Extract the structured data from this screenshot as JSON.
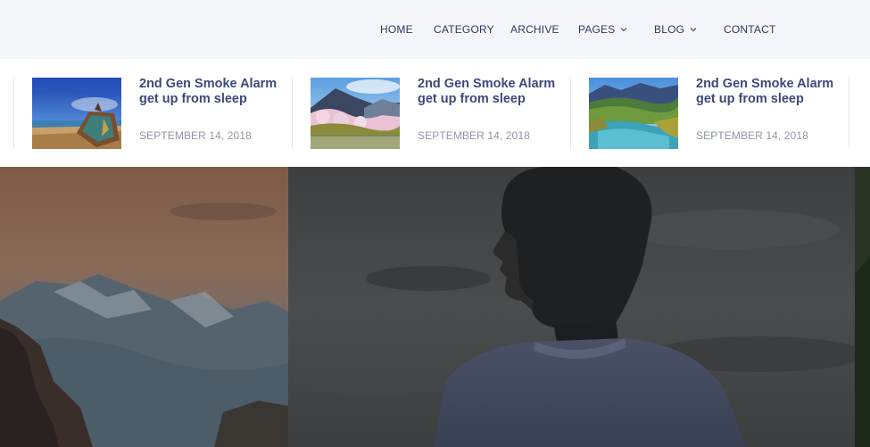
{
  "nav": {
    "items": [
      {
        "label": "HOME",
        "has_dropdown": false
      },
      {
        "label": "CATEGORY",
        "has_dropdown": false
      },
      {
        "label": "ARCHIVE",
        "has_dropdown": false
      },
      {
        "label": "PAGES",
        "has_dropdown": true
      },
      {
        "label": "BLOG",
        "has_dropdown": true
      },
      {
        "label": "CONTACT",
        "has_dropdown": false
      }
    ]
  },
  "posts": [
    {
      "title": "2nd Gen Smoke Alarm get up from sleep",
      "date": "SEPTEMBER 14, 2018",
      "thumb": "beach-shipwreck"
    },
    {
      "title": "2nd Gen Smoke Alarm get up from sleep",
      "date": "SEPTEMBER 14, 2018",
      "thumb": "blossom-mountain-lake"
    },
    {
      "title": "2nd Gen Smoke Alarm get up from sleep",
      "date": "SEPTEMBER 14, 2018",
      "thumb": "mountain-lake-valley"
    }
  ],
  "hero": {
    "slides": [
      "mountain-range-dusk",
      "man-silhouette-cloudy-sky"
    ]
  },
  "colors": {
    "nav_bg": "#f4f5f9",
    "nav_text": "#2c3a5e",
    "post_title": "#3b4a7a",
    "post_date": "#8f96a5"
  }
}
